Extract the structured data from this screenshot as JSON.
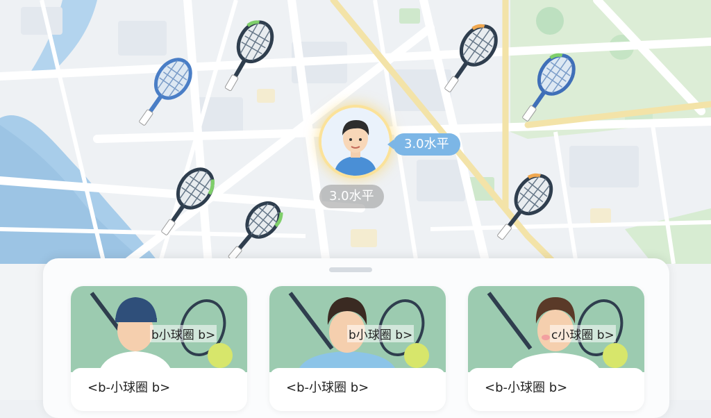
{
  "me": {
    "level_bubble": "3.0水平",
    "level_pill": "3.0水平"
  },
  "cards": [
    {
      "photo_text": "b小球圈 b>",
      "name": "<b-小球圈 b>"
    },
    {
      "photo_text": "b小球圈 b>",
      "name": "<b-小球圈 b>"
    },
    {
      "photo_text": "c小球圈 b>",
      "name": "<b-小球圈 b>"
    }
  ],
  "colors": {
    "water": "#9cc6e6",
    "park": "#d9ecd4",
    "bubble": "#7cb6e6",
    "card_bg": "#9ccbb0"
  }
}
